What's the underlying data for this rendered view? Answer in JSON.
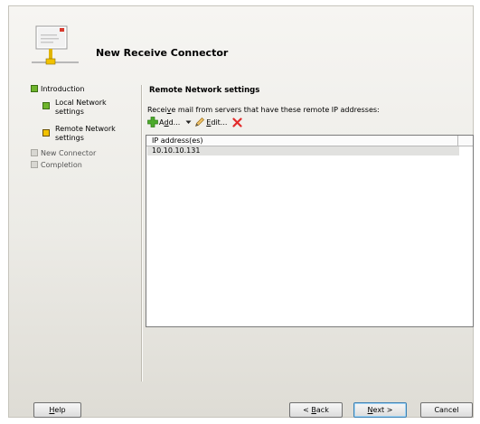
{
  "window": {
    "title": "New Receive Connector"
  },
  "nav": {
    "items": [
      {
        "label": "Introduction",
        "state": "complete"
      },
      {
        "label": "Local Network settings",
        "line1": "Local Network",
        "line2": "settings",
        "state": "complete"
      },
      {
        "label": "Remote Network settings",
        "line1": "Remote Network",
        "line2": "settings",
        "state": "current"
      },
      {
        "label": "New Connector",
        "state": "pending"
      },
      {
        "label": "Completion",
        "state": "pending"
      }
    ]
  },
  "page": {
    "section_title": "Remote Network settings",
    "prompt_pre": "Recei",
    "prompt_key": "v",
    "prompt_post": "e mail from servers that have these remote IP addresses:",
    "toolbar": {
      "add_pre": "A",
      "add_key": "d",
      "add_post": "d...",
      "edit_key": "E",
      "edit_post": "dit..."
    },
    "list": {
      "column_header": "IP address(es)",
      "rows": [
        "10.10.10.131"
      ]
    }
  },
  "footer": {
    "help_key": "H",
    "help_post": "elp",
    "back_pre": "< ",
    "back_key": "B",
    "back_post": "ack",
    "next_key": "N",
    "next_post": "ext >",
    "cancel_label": "Cancel"
  },
  "icons": {
    "header": "network-connector-icon",
    "add": "green-plus-icon",
    "dropdown": "dropdown-arrow-icon",
    "edit": "pencil-icon",
    "remove": "red-x-icon"
  },
  "colors": {
    "complete_bullet": "#6fb52c",
    "current_bullet": "#f2c200",
    "pending_bullet": "#d8d7d2",
    "remove_icon": "#e22b2b",
    "add_icon": "#4caa2b"
  }
}
